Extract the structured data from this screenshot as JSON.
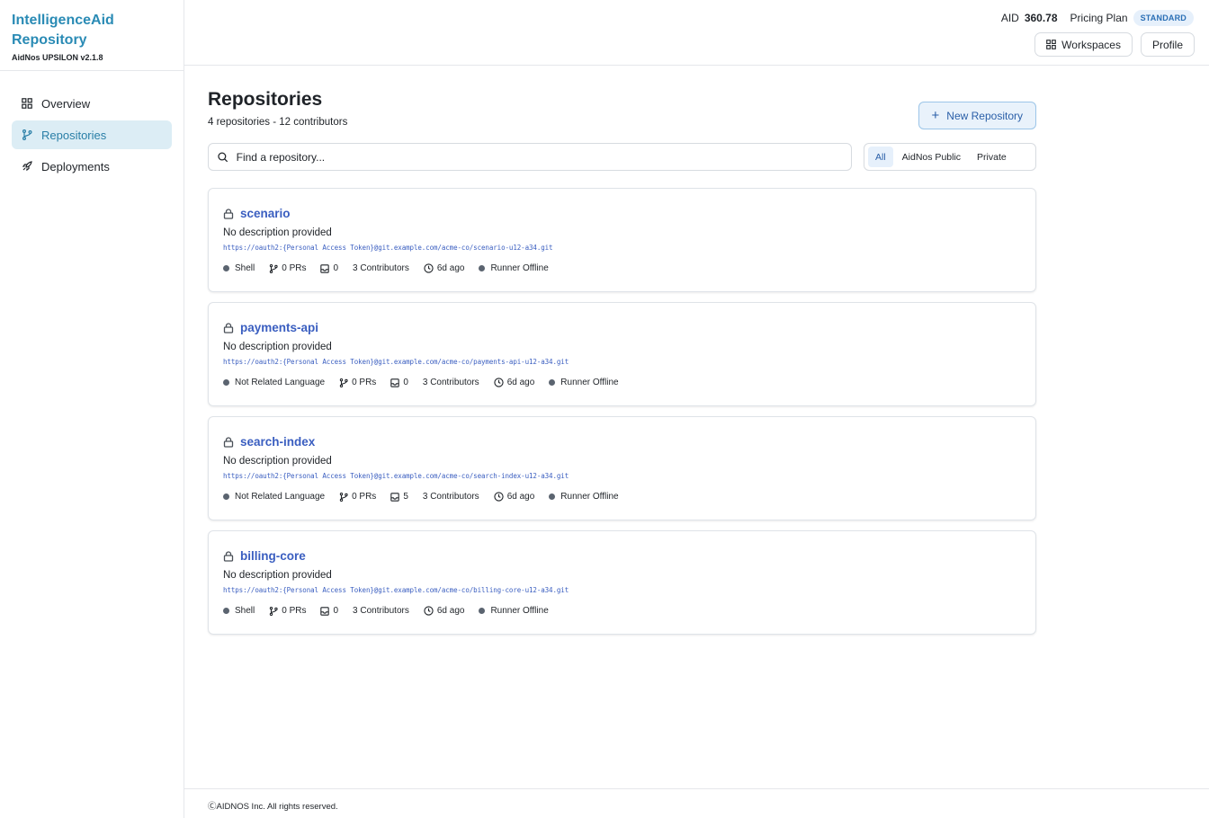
{
  "brand": {
    "title_line1": "IntelligenceAid",
    "title_line2": "Repository",
    "version": "AidNos UPSILON v2.1.8"
  },
  "sidebar": {
    "items": [
      {
        "label": "Overview",
        "icon": "grid-icon",
        "active": false
      },
      {
        "label": "Repositories",
        "icon": "branch-icon",
        "active": true
      },
      {
        "label": "Deployments",
        "icon": "rocket-icon",
        "active": false
      }
    ]
  },
  "header": {
    "aid_label": "AID",
    "aid_value": "360.78",
    "plan_label": "Pricing Plan",
    "plan_badge": "STANDARD",
    "workspaces_label": "Workspaces",
    "profile_label": "Profile"
  },
  "main": {
    "title": "Repositories",
    "subtitle": "4 repositories - 12 contributors",
    "new_repo_label": "New Repository",
    "search_placeholder": "Find a repository...",
    "filters": [
      {
        "label": "All",
        "active": true
      },
      {
        "label": "AidNos Public",
        "active": false
      },
      {
        "label": "Private",
        "active": false
      }
    ]
  },
  "repos": [
    {
      "name": "scenario",
      "description": "No description provided",
      "url": "https://oauth2:{Personal Access Token}@git.example.com/acme-co/scenario-u12-a34.git",
      "language": "Shell",
      "prs": "0 PRs",
      "issues": "0",
      "contributors": "3 Contributors",
      "updated": "6d ago",
      "runner": "Runner Offline"
    },
    {
      "name": "payments-api",
      "description": "No description provided",
      "url": "https://oauth2:{Personal Access Token}@git.example.com/acme-co/payments-api-u12-a34.git",
      "language": "Not Related Language",
      "prs": "0 PRs",
      "issues": "0",
      "contributors": "3 Contributors",
      "updated": "6d ago",
      "runner": "Runner Offline"
    },
    {
      "name": "search-index",
      "description": "No description provided",
      "url": "https://oauth2:{Personal Access Token}@git.example.com/acme-co/search-index-u12-a34.git",
      "language": "Not Related Language",
      "prs": "0 PRs",
      "issues": "5",
      "contributors": "3 Contributors",
      "updated": "6d ago",
      "runner": "Runner Offline"
    },
    {
      "name": "billing-core",
      "description": "No description provided",
      "url": "https://oauth2:{Personal Access Token}@git.example.com/acme-co/billing-core-u12-a34.git",
      "language": "Shell",
      "prs": "0 PRs",
      "issues": "0",
      "contributors": "3 Contributors",
      "updated": "6d ago",
      "runner": "Runner Offline"
    }
  ],
  "footer": {
    "text": "ⒸAIDNOS Inc. All rights reserved."
  },
  "colors": {
    "brand": "#2a8bb5",
    "link": "#3a5ec0",
    "active_bg": "#dcedf5",
    "dot": "#5b6470"
  }
}
